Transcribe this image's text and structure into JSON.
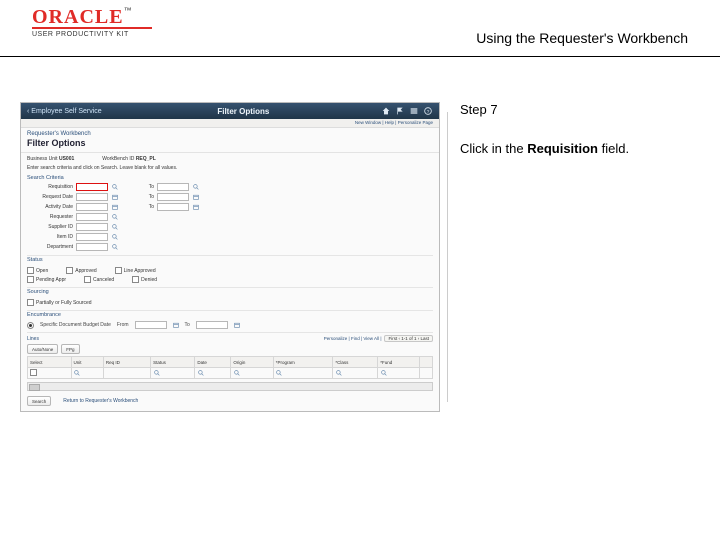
{
  "header": {
    "brand": "ORACLE",
    "brand_tm": "™",
    "brand_sub": "USER PRODUCTIVITY KIT",
    "doc_title": "Using the Requester's Workbench"
  },
  "instruction_panel": {
    "step_label": "Step 7",
    "text_prefix": "Click in the ",
    "text_bold": "Requisition",
    "text_suffix": " field."
  },
  "screenshot": {
    "titlebar": {
      "back_label": "‹ Employee Self Service",
      "title": "Filter Options",
      "icons": [
        "home-icon",
        "flag-icon",
        "menu-icon",
        "help-icon"
      ]
    },
    "subbar_text": "New Window | Help | Personalize Page",
    "breadcrumb": "Requester's Workbench",
    "page_heading": "Filter Options",
    "id_row": {
      "left_label": "Business Unit",
      "left_value": "US001",
      "right_label": "WorkBench ID",
      "right_value": "REQ_PL"
    },
    "instr": "Enter search criteria and click on Search. Leave blank for all values.",
    "section_search": "Search Criteria",
    "fields": [
      {
        "label": "Requisition",
        "has_to": true,
        "highlight": true
      },
      {
        "label": "Request Date",
        "has_to": true
      },
      {
        "label": "Activity Date",
        "has_to": true
      },
      {
        "label": "Requester",
        "has_to": false
      },
      {
        "label": "Supplier ID",
        "has_to": false
      },
      {
        "label": "Item ID",
        "has_to": false
      },
      {
        "label": "Department",
        "has_to": false
      }
    ],
    "to_label": "To",
    "status_section": "Status",
    "status_options": [
      "Open",
      "Pending Appr",
      "Approved",
      "Canceled",
      "Line Approved",
      "Denied"
    ],
    "sourcing_section": "Sourcing",
    "sourcing_options": [
      "Partially or Fully Sourced"
    ],
    "encumbrance_section": "Encumbrance",
    "radio_label": "Specific Document Budget Date",
    "date_from_label": "From",
    "date_to_label": "To",
    "grid_toolbar": {
      "link": "Lines",
      "legend": "Personalize | Find | View All | ",
      "pager": "First ‹ 1-1 of 1 › Last"
    },
    "grid_buttons": [
      "Auto/None",
      "FPg"
    ],
    "grid": {
      "columns": [
        "Select",
        "Unit",
        "Req ID",
        "Status",
        "Date",
        "Origin",
        "*Program",
        "*Class",
        "*Fund",
        ""
      ],
      "row": [
        "",
        "",
        "",
        "",
        "",
        "",
        "",
        "",
        "",
        ""
      ]
    },
    "lookup_icons": [
      "",
      "",
      "",
      "",
      "",
      "",
      ""
    ],
    "footer": {
      "search_btn": "Search",
      "return_link": "Return to Requester's Workbench"
    }
  }
}
